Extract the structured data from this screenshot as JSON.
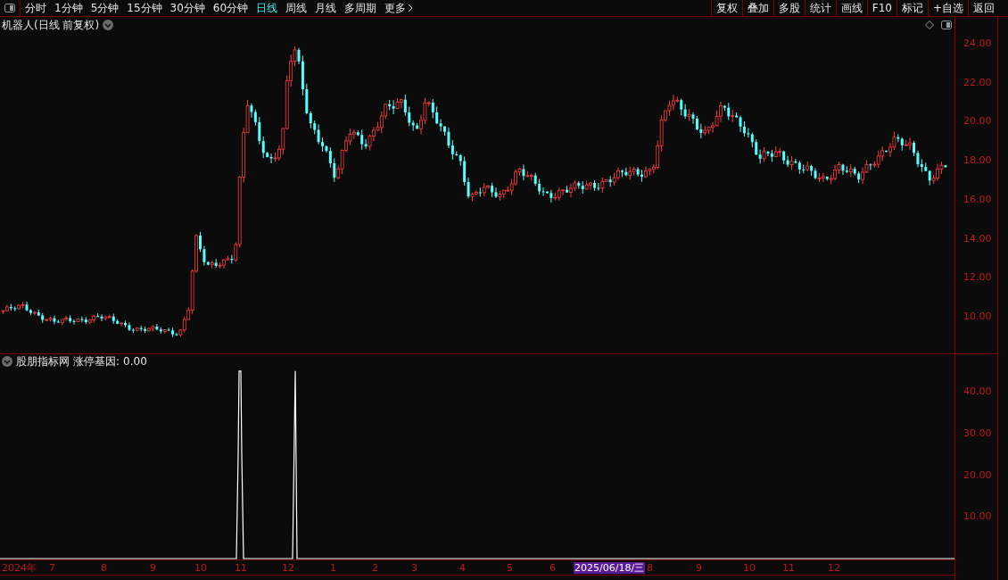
{
  "toolbar": {
    "periods": [
      {
        "label": "分时",
        "selected": false
      },
      {
        "label": "1分钟",
        "selected": false
      },
      {
        "label": "5分钟",
        "selected": false
      },
      {
        "label": "15分钟",
        "selected": false
      },
      {
        "label": "30分钟",
        "selected": false
      },
      {
        "label": "60分钟",
        "selected": false
      },
      {
        "label": "日线",
        "selected": true
      },
      {
        "label": "周线",
        "selected": false
      },
      {
        "label": "月线",
        "selected": false
      },
      {
        "label": "多周期",
        "selected": false
      }
    ],
    "more": "更多",
    "actions": [
      "复权",
      "叠加",
      "多股",
      "统计",
      "画线",
      "F10",
      "标记",
      "+自选",
      "返回"
    ]
  },
  "price_panel": {
    "title": "机器人(日线 前复权)",
    "y_axis": [
      "24.00",
      "22.00",
      "20.00",
      "18.00",
      "16.00",
      "14.00",
      "12.00",
      "10.00"
    ]
  },
  "indicator_panel": {
    "source": "股朋指标网",
    "name": "涨停基因:",
    "value": "0.00",
    "y_axis": [
      "40.00",
      "30.00",
      "20.00",
      "10.00"
    ]
  },
  "date_axis": [
    {
      "label": "2024年",
      "selected": false
    },
    {
      "label": "7",
      "selected": false
    },
    {
      "label": "8",
      "selected": false
    },
    {
      "label": "9",
      "selected": false
    },
    {
      "label": "10",
      "selected": false
    },
    {
      "label": "11",
      "selected": false
    },
    {
      "label": "12",
      "selected": false
    },
    {
      "label": "1",
      "selected": false
    },
    {
      "label": "2",
      "selected": false
    },
    {
      "label": "3",
      "selected": false
    },
    {
      "label": "4",
      "selected": false
    },
    {
      "label": "5",
      "selected": false
    },
    {
      "label": "6",
      "selected": false
    },
    {
      "label": "2025/06/18/三",
      "selected": true
    },
    {
      "label": "8",
      "selected": false
    },
    {
      "label": "9",
      "selected": false
    },
    {
      "label": "10",
      "selected": false
    },
    {
      "label": "11",
      "selected": false
    },
    {
      "label": "12",
      "selected": false
    }
  ]
}
